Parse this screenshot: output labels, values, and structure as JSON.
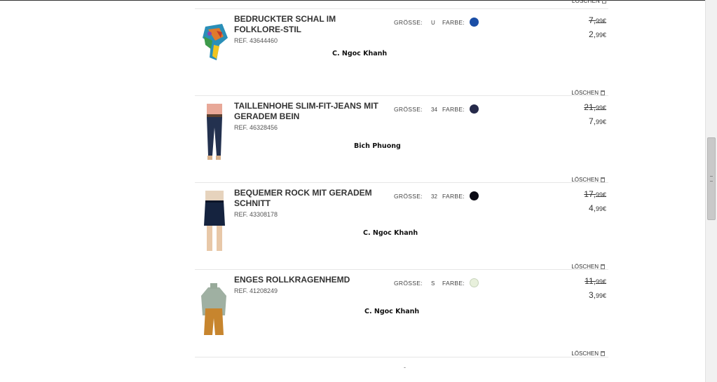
{
  "cart": {
    "delete_label": "LÖSCHEN",
    "size_label": "GRÖSSE:",
    "color_label": "FARBE:",
    "items": [
      {
        "name": "BEDRUCKTER SCHAL IM FOLKLORE-STIL",
        "ref": "REF. 43644460",
        "size": "U",
        "color": "#1a4ea6",
        "old_price_main": "7,",
        "old_price_cents": "99€",
        "new_price_main": "2,",
        "new_price_cents": "99€",
        "note": "C. Ngoc Khanh"
      },
      {
        "name": "TAILLENHOHE SLIM-FIT-JEANS MIT GERADEM BEIN",
        "ref": "REF. 46328456",
        "size": "34",
        "color": "#262a4a",
        "old_price_main": "21,",
        "old_price_cents": "99€",
        "new_price_main": "7,",
        "new_price_cents": "99€",
        "note": "Bich Phuong"
      },
      {
        "name": "BEQUEMER ROCK MIT GERADEM SCHNITT",
        "ref": "REF. 43308178",
        "size": "32",
        "color": "#0a0a14",
        "old_price_main": "17,",
        "old_price_cents": "99€",
        "new_price_main": "4,",
        "new_price_cents": "99€",
        "note": "C. Ngoc Khanh"
      },
      {
        "name": "ENGES ROLLKRAGENHEMD",
        "ref": "REF. 41208249",
        "size": "S",
        "color": "#e8f0dc",
        "old_price_main": "11,",
        "old_price_cents": "99€",
        "new_price_main": "3,",
        "new_price_cents": "99€",
        "note": "C. Ngoc Khanh"
      }
    ]
  },
  "footer": {
    "dot": "-"
  }
}
